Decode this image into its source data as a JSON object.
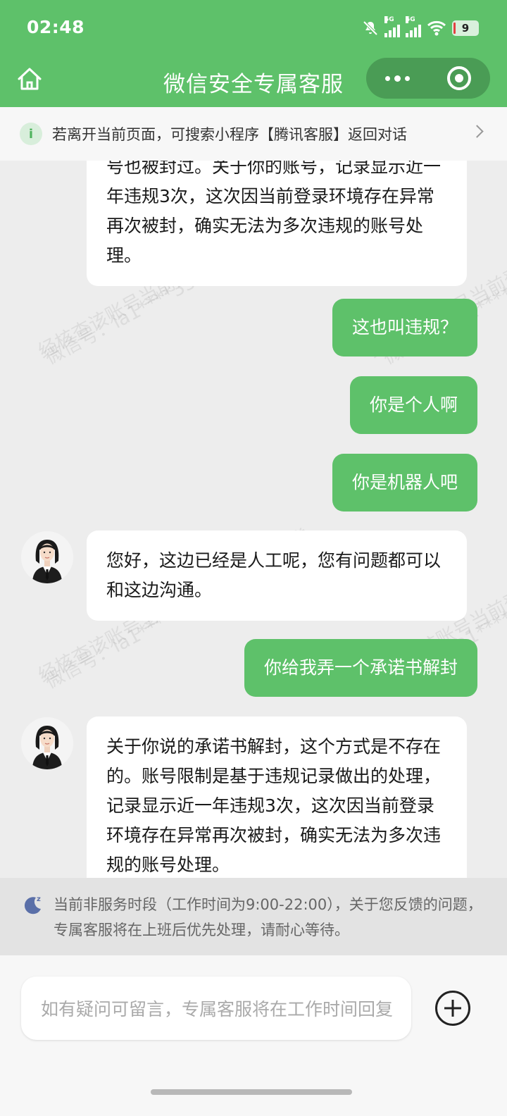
{
  "status_bar": {
    "time": "02:48",
    "network_1": "5G",
    "network_2": "5G",
    "battery": "9"
  },
  "header": {
    "title": "微信安全专属客服"
  },
  "notice": {
    "text": "若离开当前页面，可搜索小程序【腾讯客服】返回对话"
  },
  "watermarks": [
    "经核查该账号当前登录环境存在异常",
    "微信号：la1****351",
    "经核查该账号当前登录环境存在异常",
    "微信号：la1****351",
    "经核查该账号当前登录环境存在异常",
    "微信号：la1****351",
    "经核查该账号当前登录环境存在异常",
    "微信号：la1****351"
  ],
  "messages": [
    {
      "sender": "agent",
      "text": "号也被封过。关于你的账号，记录显示近一年违规3次，这次因当前登录环境存在异常再次被封，确实无法为多次违规的账号处理。"
    },
    {
      "sender": "user",
      "text": "这也叫违规？"
    },
    {
      "sender": "user",
      "text": "你是个人啊"
    },
    {
      "sender": "user",
      "text": "你是机器人吧"
    },
    {
      "sender": "agent",
      "text": "您好，这边已经是人工呢，您有问题都可以和这边沟通。"
    },
    {
      "sender": "user",
      "text": "你给我弄一个承诺书解封"
    },
    {
      "sender": "agent",
      "text": "关于你说的承诺书解封，这个方式是不存在的。账号限制是基于违规记录做出的处理，记录显示近一年违规3次，这次因当前登录环境存在异常再次被封，确实无法为多次违规的账号处理。"
    }
  ],
  "service_hours": {
    "text": "当前非服务时段（工作时间为9:00-22:00），关于您反馈的问题，专属客服将在上班后优先处理，请耐心等待。"
  },
  "composer": {
    "placeholder": "如有疑问可留言，专属客服将在工作时间回复"
  }
}
